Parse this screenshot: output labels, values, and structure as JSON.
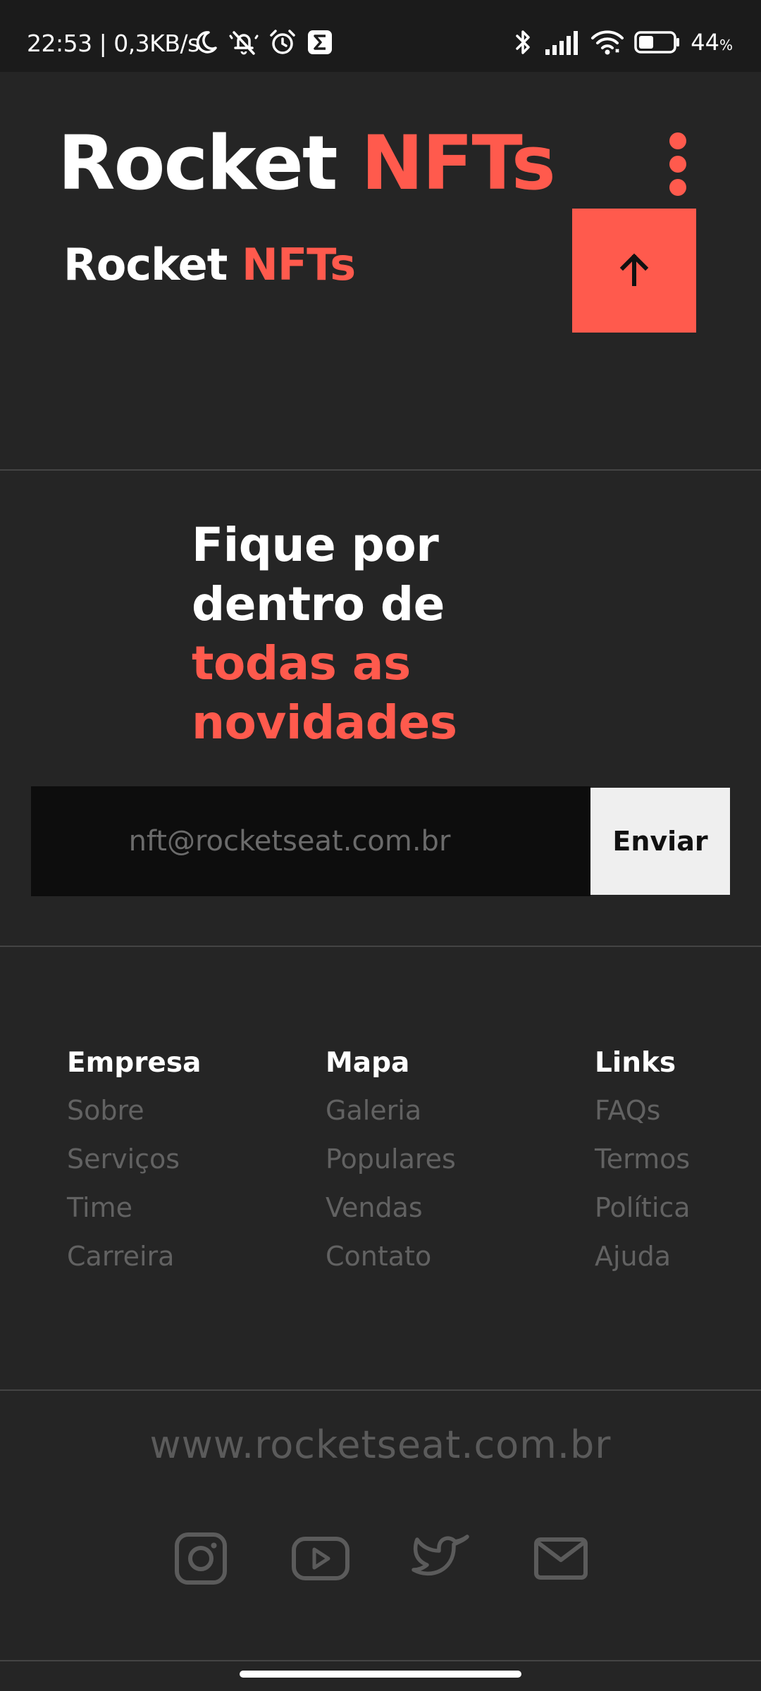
{
  "status_bar": {
    "time_speed": "22:53 | 0,3KB/s",
    "battery_percent": "44",
    "battery_unit": "%",
    "battery_level": 0.44,
    "icons": [
      "moon-icon",
      "silent-bell-icon",
      "alarm-icon",
      "sigma-app-icon",
      "bluetooth-icon",
      "cellular-signal-icon",
      "wifi-icon",
      "battery-icon"
    ]
  },
  "header": {
    "brand_main": "Rocket",
    "brand_accent": "NFTs",
    "sub_brand_main": "Rocket",
    "sub_brand_accent": "NFTs",
    "menu_icon": "more-vertical-icon",
    "scroll_top_icon": "arrow-up-icon"
  },
  "newsletter": {
    "title_line1": "Fique por",
    "title_line2": "dentro de",
    "title_line3": "todas as",
    "title_line4": "novidades",
    "email_placeholder": "nft@rocketseat.com.br",
    "submit_label": "Enviar"
  },
  "footer": {
    "columns": [
      {
        "heading": "Empresa",
        "links": [
          "Sobre",
          "Serviços",
          "Time",
          "Carreira"
        ]
      },
      {
        "heading": "Mapa",
        "links": [
          "Galeria",
          "Populares",
          "Vendas",
          "Contato"
        ]
      },
      {
        "heading": "Links",
        "links": [
          "FAQs",
          "Termos",
          "Política",
          "Ajuda"
        ]
      }
    ],
    "website": "www.rocketseat.com.br",
    "social_icons": [
      "instagram-icon",
      "youtube-icon",
      "twitter-icon",
      "mail-icon"
    ]
  },
  "colors": {
    "background": "#252525",
    "status_bar": "#1b1b1b",
    "accent": "#ff5a4d",
    "input_bg": "#0d0d0d",
    "button_bg": "#efefef",
    "muted_text": "#626262"
  }
}
